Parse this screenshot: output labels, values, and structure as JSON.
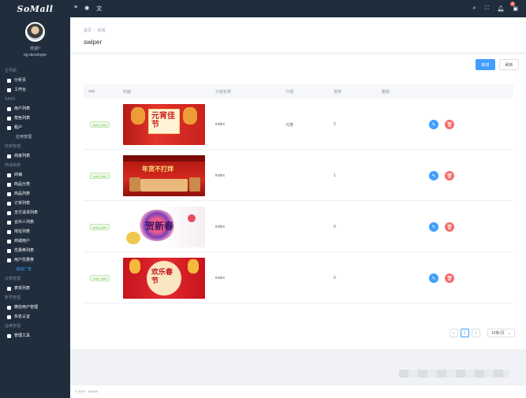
{
  "brand": "SoMall",
  "user": {
    "greeting": "欢迎!!",
    "name": "ng-developer"
  },
  "menu": [
    {
      "type": "group",
      "label": "主导航"
    },
    {
      "type": "item",
      "label": "分析页",
      "icon": "chart-icon"
    },
    {
      "type": "item",
      "label": "工作台",
      "icon": "monitor-icon"
    },
    {
      "type": "group",
      "label": "SAAS"
    },
    {
      "type": "item",
      "label": "用户列表",
      "icon": "user-icon"
    },
    {
      "type": "item",
      "label": "角色列表",
      "icon": "key-icon"
    },
    {
      "type": "item",
      "label": "租户",
      "icon": "key-icon"
    },
    {
      "type": "sub",
      "label": "应用管理"
    },
    {
      "type": "group",
      "label": "商家管理"
    },
    {
      "type": "item",
      "label": "商家列表",
      "icon": "store-icon"
    },
    {
      "type": "group",
      "label": "商城系统"
    },
    {
      "type": "item",
      "label": "商铺",
      "icon": "shop-icon"
    },
    {
      "type": "item",
      "label": "商品分类",
      "icon": "sitemap-icon"
    },
    {
      "type": "item",
      "label": "商品列表",
      "icon": "pin-icon"
    },
    {
      "type": "item",
      "label": "订单列表",
      "icon": "bank-icon"
    },
    {
      "type": "item",
      "label": "支付请求列表",
      "icon": "bank-icon"
    },
    {
      "type": "item",
      "label": "合伙人列表",
      "icon": "bank-icon"
    },
    {
      "type": "item",
      "label": "地址列表",
      "icon": "list-icon"
    },
    {
      "type": "item",
      "label": "商城用户",
      "icon": "person-icon"
    },
    {
      "type": "item",
      "label": "优惠券列表",
      "icon": "person-icon"
    },
    {
      "type": "item",
      "label": "用户优惠券",
      "icon": "person-icon"
    },
    {
      "type": "sub",
      "label": "滚动广告",
      "active": true
    },
    {
      "type": "group",
      "label": "云表管理"
    },
    {
      "type": "item",
      "label": "表单列表",
      "icon": "form-icon"
    },
    {
      "type": "group",
      "label": "账号管理"
    },
    {
      "type": "item",
      "label": "微信用户管理",
      "icon": "wechat-icon"
    },
    {
      "type": "item",
      "label": "实名认证",
      "icon": "id-icon"
    },
    {
      "type": "group",
      "label": "运维管理"
    },
    {
      "type": "item",
      "label": "管理工具",
      "icon": "tool-icon"
    }
  ],
  "breadcrumb": [
    "首页",
    "商城"
  ],
  "page_title": "swiper",
  "toolbar": {
    "add_label": "新增",
    "refresh_label": "刷新"
  },
  "table": {
    "headers": [
      "app",
      "封面",
      "分组名称",
      "介绍",
      "排序",
      "删除"
    ],
    "rows": [
      {
        "app": "mall_mini",
        "cover_text": "元宵佳节",
        "group": "index",
        "intro": "元宵",
        "sort": "2"
      },
      {
        "app": "mall_mini",
        "cover_text": "年货不打烊",
        "group": "index",
        "intro": "",
        "sort": "1"
      },
      {
        "app": "mall_mini",
        "cover_text": "贺新春",
        "group": "index",
        "intro": "",
        "sort": "0"
      },
      {
        "app": "mall_mini",
        "cover_text": "欢乐春节",
        "group": "index",
        "intro": "",
        "sort": "0"
      }
    ]
  },
  "pagination": {
    "prev": "‹",
    "current": "1",
    "next": "›",
    "page_size": "10条/页"
  },
  "footer": "© 2020 · SoMall",
  "colors": {
    "sidebar": "#1f2d3d",
    "primary": "#409eff",
    "danger": "#f56c6c",
    "tag": "#67c23a"
  }
}
